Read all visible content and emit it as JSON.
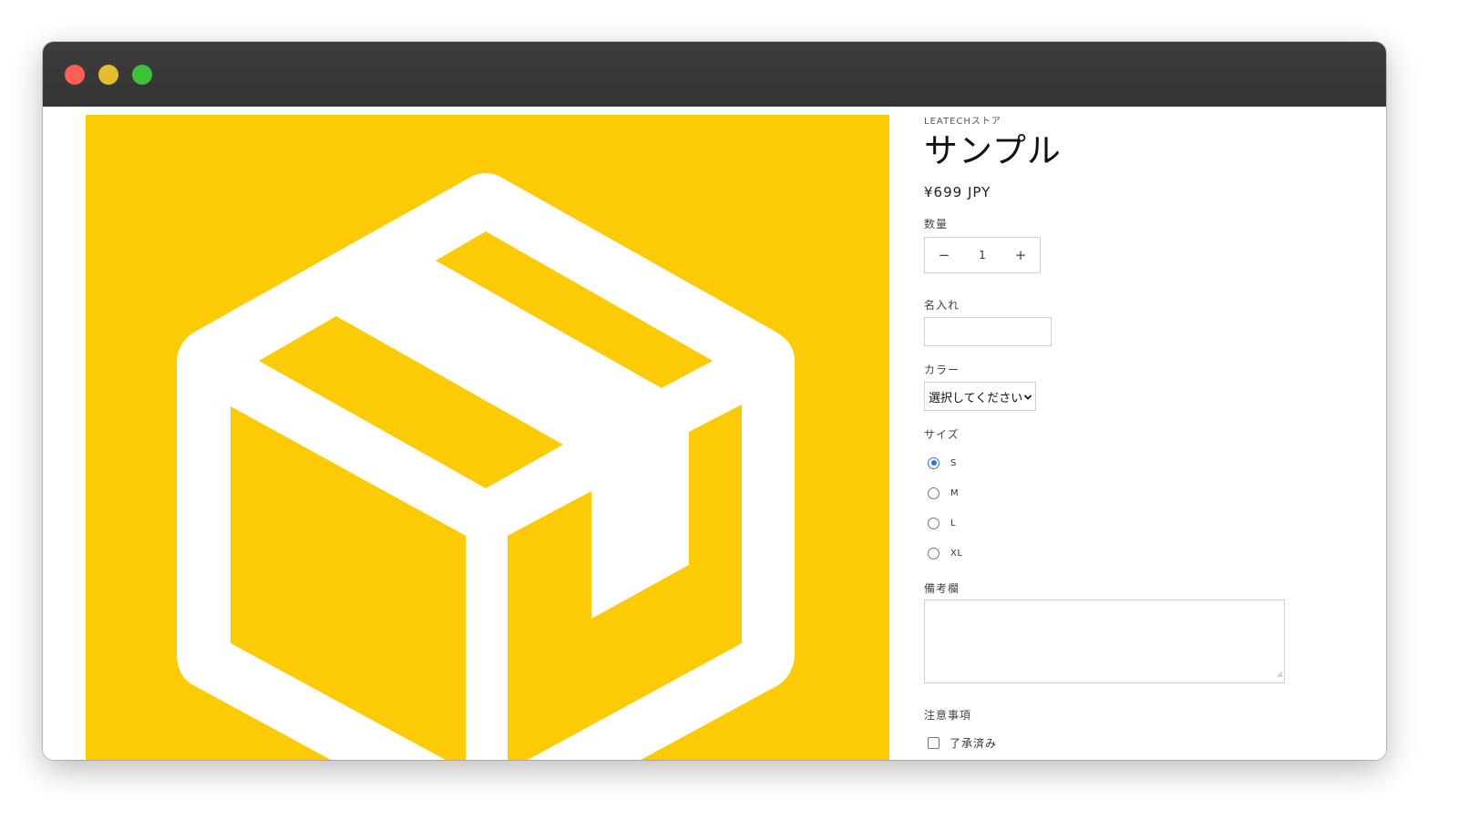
{
  "window": {
    "traffic_lights": [
      "close",
      "minimize",
      "maximize"
    ]
  },
  "product": {
    "image_icon": "package-box-icon",
    "image_background": "#fdca06",
    "vendor": "LEATECHストア",
    "title": "サンプル",
    "price": "¥699 JPY"
  },
  "quantity": {
    "label": "数量",
    "minus": "−",
    "value": "1",
    "plus": "+"
  },
  "name_field": {
    "label": "名入れ",
    "value": ""
  },
  "color": {
    "label": "カラー",
    "selected": "選択してください"
  },
  "size": {
    "label": "サイズ",
    "options": [
      {
        "label": "S",
        "checked": true
      },
      {
        "label": "M",
        "checked": false
      },
      {
        "label": "L",
        "checked": false
      },
      {
        "label": "XL",
        "checked": false
      }
    ]
  },
  "notes": {
    "label": "備考欄",
    "value": ""
  },
  "terms": {
    "label": "注意事項",
    "checkbox_label": "了承済み",
    "checked": false
  }
}
